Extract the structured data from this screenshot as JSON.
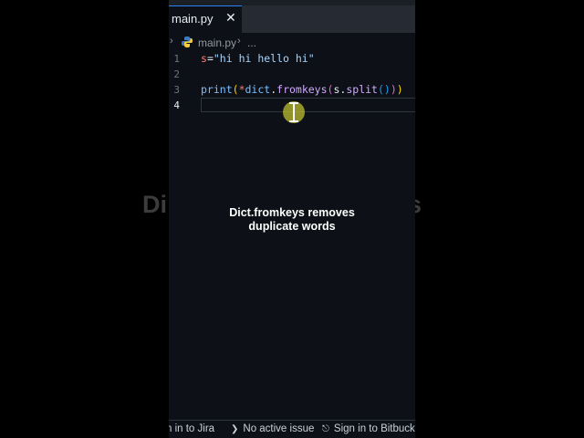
{
  "background_caption": {
    "left_fragment": "Di",
    "right_fragment": "es"
  },
  "editor": {
    "tab": {
      "label": "main.py",
      "close_glyph": "✕"
    },
    "breadcrumb": {
      "chevron": "›",
      "file": "main.py",
      "separator": "›",
      "more": "..."
    },
    "lines": [
      {
        "number": "1",
        "text": "s=\"hi hi hello hi\""
      },
      {
        "number": "2",
        "text": ""
      },
      {
        "number": "3",
        "text": "print(*dict.fromkeys(s.split()))"
      },
      {
        "number": "4",
        "text": ""
      }
    ],
    "code_tokens": {
      "line1": {
        "var": "s",
        "op": "=",
        "str": "\"hi hi hello hi\""
      },
      "line3": {
        "fn": "print",
        "p1_open": "(",
        "star": "*",
        "obj": "dict",
        "dot1": ".",
        "method": "fromkeys",
        "p2_open": "(",
        "arg": "s",
        "dot2": ".",
        "method2": "split",
        "p3": "()",
        "p2_close": ")",
        "p1_close": ")"
      }
    }
  },
  "subtitle": {
    "line1": "Dict.fromkeys removes",
    "line2": "duplicate words"
  },
  "statusbar": {
    "jira": "n in to Jira",
    "issue": "No active issue",
    "bitbucket": "Sign in to Bitbucke"
  },
  "colors": {
    "editor_bg": "#0d1117",
    "string": "#a5d6ff",
    "keyword_var": "#ff7b72",
    "function": "#d2a8ff",
    "cursor_highlight": "#bebe32"
  },
  "icons": {
    "python_file": "python-icon",
    "issue_status": "chevron-right-icon",
    "bitbucket_status": "bitbucket-icon"
  }
}
